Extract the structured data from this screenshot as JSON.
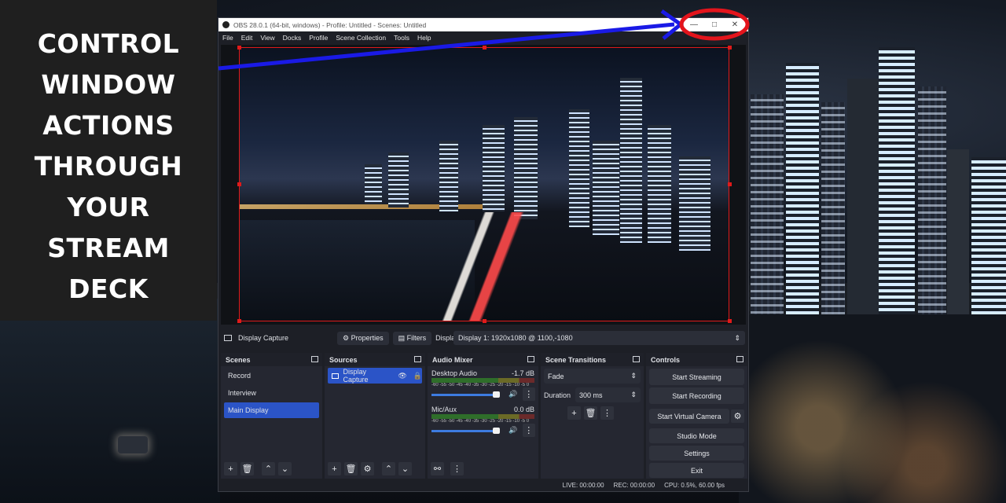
{
  "caption": {
    "lines": [
      "CONTROL",
      "WINDOW",
      "ACTIONS",
      "THROUGH",
      "YOUR",
      "STREAM",
      "DECK"
    ]
  },
  "window": {
    "title": "OBS 28.0.1 (64-bit, windows) - Profile: Untitled - Scenes: Untitled",
    "controls": {
      "minimize": "—",
      "maximize": "□",
      "close": "✕"
    }
  },
  "menu": [
    "File",
    "Edit",
    "View",
    "Docks",
    "Profile",
    "Scene Collection",
    "Tools",
    "Help"
  ],
  "source_bar": {
    "source_name": "Display Capture",
    "properties_label": "Properties",
    "filters_label": "Filters",
    "display_label": "Display",
    "display_value": "Display 1: 1920x1080 @ 1100,-1080"
  },
  "scenes": {
    "title": "Scenes",
    "items": [
      "Record",
      "Interview",
      "Main Display"
    ],
    "selected": "Main Display"
  },
  "sources": {
    "title": "Sources",
    "items": [
      "Display Capture"
    ]
  },
  "audio_mixer": {
    "title": "Audio Mixer",
    "scale": "-60 -55 -50 -45 -40 -35 -30 -25 -20 -15 -10 -5 0",
    "channels": [
      {
        "name": "Desktop Audio",
        "level": "-1.7 dB"
      },
      {
        "name": "Mic/Aux",
        "level": "0.0 dB"
      }
    ]
  },
  "transitions": {
    "title": "Scene Transitions",
    "type": "Fade",
    "duration_label": "Duration",
    "duration_value": "300 ms"
  },
  "controls": {
    "title": "Controls",
    "buttons": [
      "Start Streaming",
      "Start Recording",
      "Start Virtual Camera",
      "Studio Mode",
      "Settings",
      "Exit"
    ]
  },
  "status": {
    "live": "LIVE: 00:00:00",
    "rec": "REC: 00:00:00",
    "cpu": "CPU: 0.5%, 60.00 fps"
  },
  "annotation_colors": {
    "arrow": "#1a1ae6",
    "circle": "#e3141c",
    "selection": "#e01a1a"
  }
}
